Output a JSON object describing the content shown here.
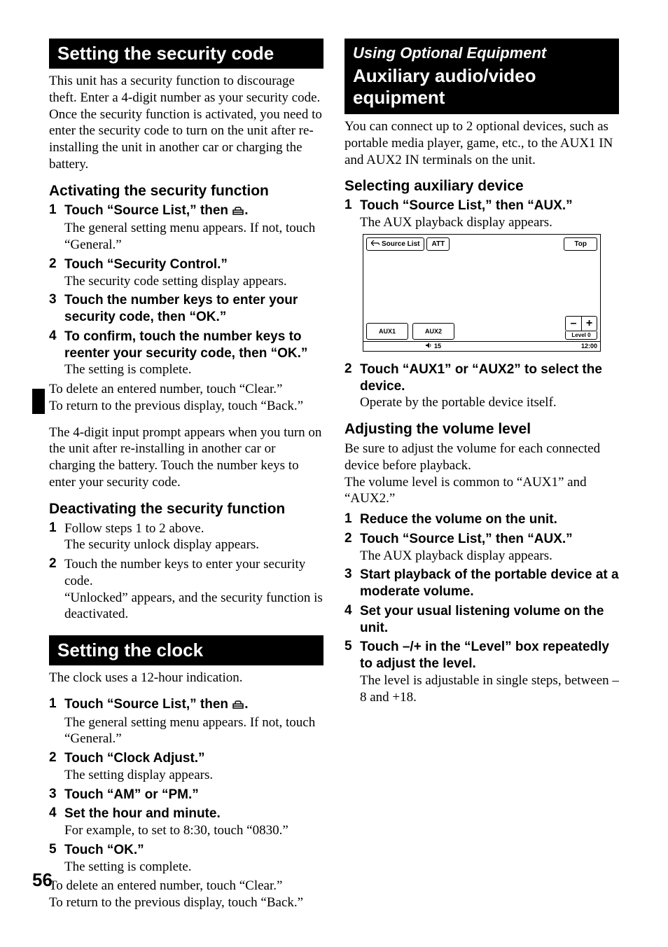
{
  "pageNumber": "56",
  "left": {
    "sec1_title": "Setting the security code",
    "sec1_intro": "This unit has a security function to discourage theft. Enter a 4-digit number as your security code.\nOnce the security function is activated, you need to enter the security code to turn on the unit after re-installing the unit in another car or charging the battery.",
    "activating_heading": "Activating the security function",
    "act_step1_lead": "Touch “Source List,” then ",
    "act_step1_tail": ".",
    "act_step1_follow": "The general setting menu appears. If not, touch “General.”",
    "act_step2_lead": "Touch “Security Control.”",
    "act_step2_follow": "The security code setting display appears.",
    "act_step3_lead": "Touch the number keys to enter your security code, then “OK.”",
    "act_step4_lead": "To confirm, touch the number keys to reenter your security code, then “OK.”",
    "act_step4_follow": "The setting is complete.",
    "act_note1": "To delete an entered number, touch “Clear.”\nTo return to the previous display, touch “Back.”",
    "act_note2": "The 4-digit input prompt appears when you turn on the unit after re-installing in another car or charging the battery. Touch the number keys to enter your security code.",
    "deactivating_heading": "Deactivating the security function",
    "deact_step1": "Follow steps 1 to 2 above.",
    "deact_step1_follow": "The security unlock display appears.",
    "deact_step2": "Touch the number keys to enter your security code.",
    "deact_step2_follow": "“Unlocked” appears, and the security function is deactivated.",
    "sec2_title": "Setting the clock",
    "sec2_intro": "The clock uses a 12-hour indication.",
    "clk_step1_lead": "Touch “Source List,” then ",
    "clk_step1_tail": ".",
    "clk_step1_follow": "The general setting menu appears. If not, touch “General.”",
    "clk_step2_lead": "Touch “Clock Adjust.”",
    "clk_step2_follow": "The setting display appears.",
    "clk_step3_lead": "Touch “AM” or “PM.”",
    "clk_step4_lead": "Set the hour and minute.",
    "clk_step4_follow": "For example, to set to 8:30, touch “0830.”",
    "clk_step5_lead": "Touch “OK.”",
    "clk_step5_follow": "The setting is complete.",
    "clk_note": "To delete an entered number, touch “Clear.”\nTo return to the previous display, touch “Back.”"
  },
  "right": {
    "over_title": "Using Optional Equipment",
    "sec_title": "Auxiliary audio/video equipment",
    "intro": "You can connect up to 2 optional devices, such as portable media player, game, etc., to the AUX1 IN and AUX2 IN terminals on the unit.",
    "selecting_heading": "Selecting auxiliary device",
    "sel_step1_lead": "Touch “Source List,” then “AUX.”",
    "sel_step1_follow": "The AUX playback display appears.",
    "screen": {
      "source_list": "Source List",
      "att": "ATT",
      "top": "Top",
      "aux1": "AUX1",
      "aux2": "AUX2",
      "minus": "–",
      "plus": "+",
      "level": "Level 0",
      "vol": "15",
      "clock": "12:00"
    },
    "sel_step2_lead": "Touch “AUX1” or “AUX2” to select the device.",
    "sel_step2_follow": "Operate by the portable device itself.",
    "adjust_heading": "Adjusting the volume level",
    "adjust_intro": "Be sure to adjust the volume for each connected device before playback.\nThe volume level is common to “AUX1” and “AUX2.”",
    "adj_step1_lead": "Reduce the volume on the unit.",
    "adj_step2_lead": "Touch “Source List,” then “AUX.”",
    "adj_step2_follow": "The AUX playback display appears.",
    "adj_step3_lead": "Start playback of the portable device at a moderate volume.",
    "adj_step4_lead": "Set your usual listening volume on the unit.",
    "adj_step5_lead": "Touch –/+ in the “Level” box repeatedly to adjust the level.",
    "adj_step5_follow": "The level is adjustable in single steps, between –8 and +18."
  }
}
